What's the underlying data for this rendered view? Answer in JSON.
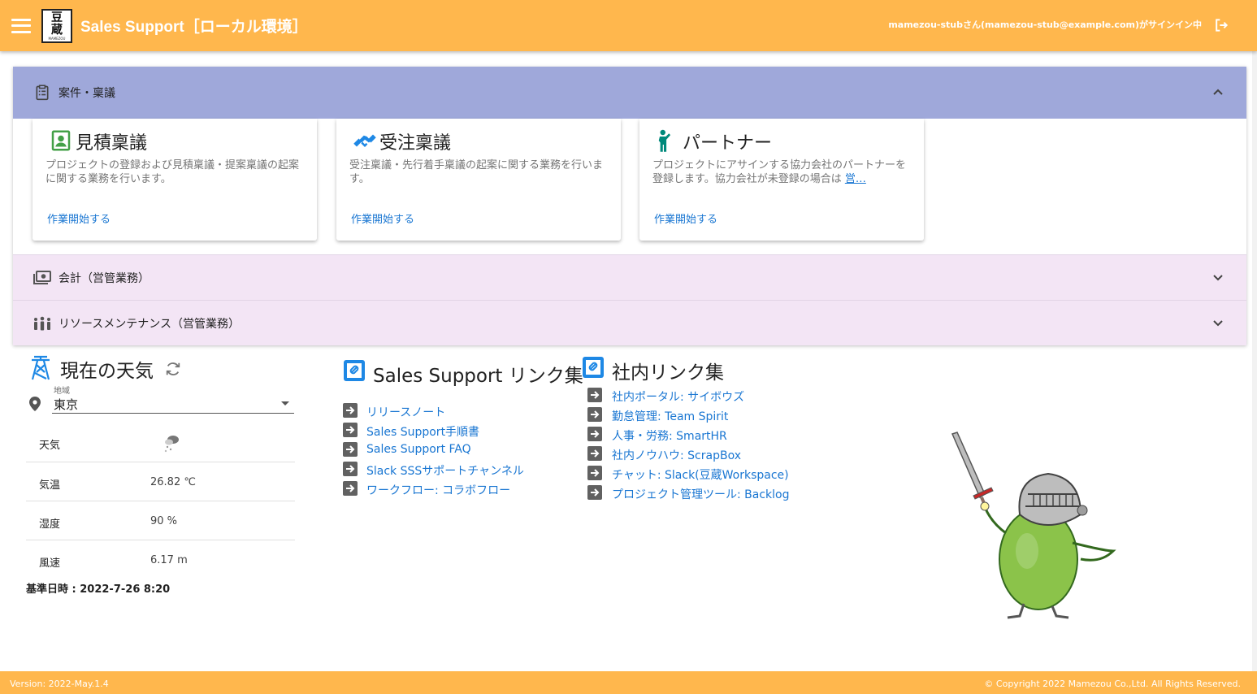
{
  "header": {
    "title": "Sales Support［ローカル環境］",
    "logo_text_1": "豆",
    "logo_text_2": "蔵",
    "logo_sub": "MAMEZOU",
    "signin_status": "mamezou-stubさん(mamezou-stub@example.com)がサインイン中"
  },
  "accordion": {
    "panels": [
      {
        "title": "案件・稟議",
        "expanded": true
      },
      {
        "title": "会計（営管業務）",
        "expanded": false
      },
      {
        "title": "リソースメンテナンス（営管業務）",
        "expanded": false
      }
    ],
    "cards": [
      {
        "title": "見積稟議",
        "desc": "プロジェクトの登録および見積稟議・提案稟議の起案に関する業務を行います。",
        "desc_link": "",
        "action": "作業開始する",
        "icon": "contact-icon",
        "color": "#43a047"
      },
      {
        "title": "受注稟議",
        "desc": "受注稟議・先行着手稟議の起案に関する業務を行います。",
        "desc_link": "",
        "action": "作業開始する",
        "icon": "handshake-icon",
        "color": "#1e88e5"
      },
      {
        "title": "パートナー",
        "desc": "プロジェクトにアサインする協力会社のパートナーを登録します。協力会社が未登録の場合は ",
        "desc_link": "営…",
        "action": "作業開始する",
        "icon": "person-icon",
        "color": "#00897b"
      }
    ]
  },
  "weather": {
    "title": "現在の天気",
    "region_label": "地域",
    "region_value": "東京",
    "rows": [
      {
        "key": "天気",
        "value": ""
      },
      {
        "key": "気温",
        "value": "26.82 ℃"
      },
      {
        "key": "湿度",
        "value": "90 %"
      },
      {
        "key": "風速",
        "value": "6.17 m"
      }
    ],
    "date": "基準日時 : 2022-7-26 8:20"
  },
  "sales_links": {
    "title": "Sales Support リンク集",
    "items": [
      "リリースノート",
      "Sales Support手順書",
      "Sales Support FAQ",
      "Slack SSSサポートチャンネル",
      "ワークフロー: コラボフロー"
    ]
  },
  "internal_links": {
    "title": "社内リンク集",
    "items": [
      "社内ポータル: サイボウズ",
      "勤怠管理: Team Spirit",
      "人事・労務: SmartHR",
      "社内ノウハウ: ScrapBox",
      "チャット: Slack(豆蔵Workspace)",
      "プロジェクト管理ツール: Backlog"
    ]
  },
  "footer": {
    "version": "Version: 2022-May.1.4",
    "copyright": "© Copyright 2022 Mamezou Co.,Ltd. All Rights Reserved."
  },
  "colors": {
    "brand": "#ffb74d",
    "panel_active": "#9fa8da",
    "panel_inactive": "#f3e5f5",
    "link": "#1976d2",
    "mascot_body": "#8bc34a"
  }
}
